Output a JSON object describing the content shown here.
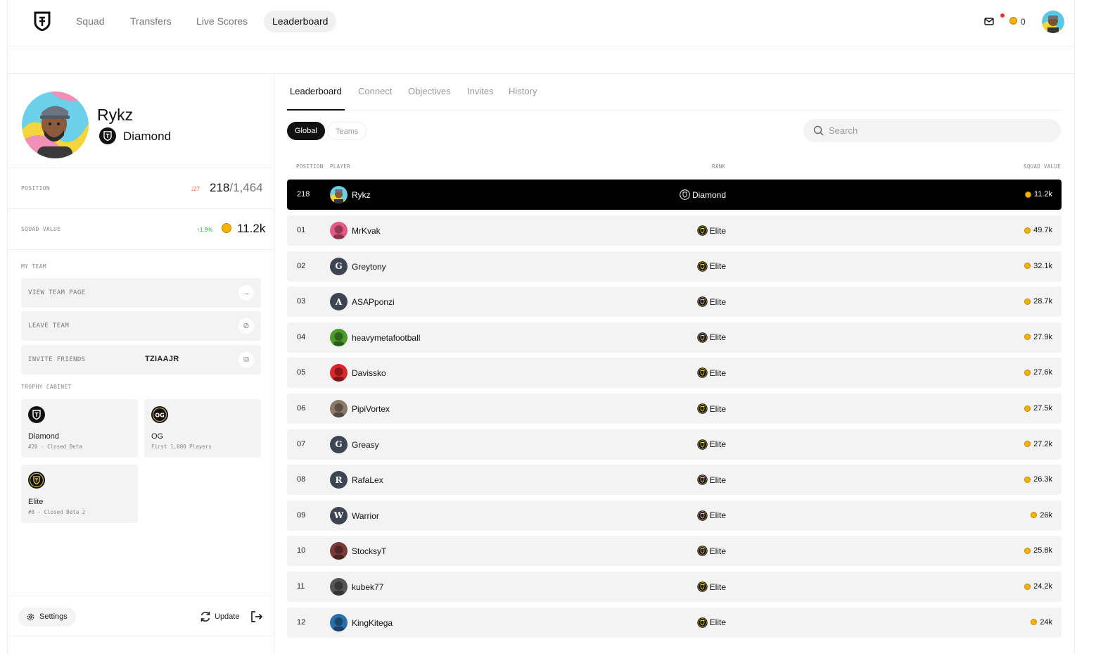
{
  "nav": {
    "items": [
      {
        "label": "Squad",
        "active": false
      },
      {
        "label": "Transfers",
        "active": false
      },
      {
        "label": "Live Scores",
        "active": false
      },
      {
        "label": "Leaderboard",
        "active": true
      }
    ],
    "coin_balance": "0",
    "icons": {
      "logo": "shield-logo-icon",
      "mail": "mail-icon",
      "coin": "coin-icon"
    }
  },
  "profile": {
    "name": "Rykz",
    "rank": "Diamond",
    "position": {
      "label": "POSITION",
      "delta": "↓27",
      "current": "218",
      "total": "/1,464"
    },
    "squad_value": {
      "label": "SQUAD VALUE",
      "delta": "↑1.9%",
      "value": "11.2k"
    },
    "my_team": {
      "label": "MY TEAM",
      "view_team": "VIEW TEAM PAGE",
      "leave_team": "LEAVE TEAM",
      "invite_friends": "INVITE FRIENDS",
      "invite_code": "TZIAAJR"
    },
    "trophy_cabinet": {
      "label": "TROPHY CABINET",
      "items": [
        {
          "name": "Diamond",
          "sub": "#20 - Closed Beta"
        },
        {
          "name": "OG",
          "sub": "First 1,000 Players"
        },
        {
          "name": "Elite",
          "sub": "#8 - Closed Beta 2"
        }
      ]
    },
    "footer": {
      "settings": "Settings",
      "update": "Update"
    }
  },
  "leaderboard": {
    "tabs": [
      "Leaderboard",
      "Connect",
      "Objectives",
      "Invites",
      "History"
    ],
    "filters": [
      "Global",
      "Teams"
    ],
    "search_placeholder": "Search",
    "columns": {
      "position": "POSITION",
      "player": "PLAYER",
      "rank": "RANK",
      "squad_value": "SQUAD VALUE"
    },
    "me": {
      "position": "218",
      "player": "Rykz",
      "rank": "Diamond",
      "value": "11.2k"
    },
    "rows": [
      {
        "position": "01",
        "player": "MrKvak",
        "rank": "Elite",
        "value": "49.7k",
        "avatar": {
          "type": "img",
          "color": "#e35a86"
        }
      },
      {
        "position": "02",
        "player": "Greytony",
        "rank": "Elite",
        "value": "32.1k",
        "avatar": {
          "type": "letter",
          "letter": "G",
          "color": "#3d4452"
        }
      },
      {
        "position": "03",
        "player": "ASAPponzi",
        "rank": "Elite",
        "value": "28.7k",
        "avatar": {
          "type": "letter",
          "letter": "A",
          "color": "#3d4452"
        }
      },
      {
        "position": "04",
        "player": "heavymetafootball",
        "rank": "Elite",
        "value": "27.9k",
        "avatar": {
          "type": "img",
          "color": "#4a9a2c"
        }
      },
      {
        "position": "05",
        "player": "Davissko",
        "rank": "Elite",
        "value": "27.6k",
        "avatar": {
          "type": "img",
          "color": "#d8262b"
        }
      },
      {
        "position": "06",
        "player": "PipiVortex",
        "rank": "Elite",
        "value": "27.5k",
        "avatar": {
          "type": "img",
          "color": "#8a7a6a"
        }
      },
      {
        "position": "07",
        "player": "Greasy",
        "rank": "Elite",
        "value": "27.2k",
        "avatar": {
          "type": "letter",
          "letter": "G",
          "color": "#3d4452"
        }
      },
      {
        "position": "08",
        "player": "RafaLex",
        "rank": "Elite",
        "value": "26.3k",
        "avatar": {
          "type": "letter",
          "letter": "R",
          "color": "#3d4452"
        }
      },
      {
        "position": "09",
        "player": "Warrior",
        "rank": "Elite",
        "value": "26k",
        "avatar": {
          "type": "letter",
          "letter": "W",
          "color": "#3d4452"
        }
      },
      {
        "position": "10",
        "player": "StocksyT",
        "rank": "Elite",
        "value": "25.8k",
        "avatar": {
          "type": "img",
          "color": "#7a3a3a"
        }
      },
      {
        "position": "11",
        "player": "kubek77",
        "rank": "Elite",
        "value": "24.2k",
        "avatar": {
          "type": "img",
          "color": "#555555"
        }
      },
      {
        "position": "12",
        "player": "KingKitega",
        "rank": "Elite",
        "value": "24k",
        "avatar": {
          "type": "img",
          "color": "#2b6fa8"
        }
      }
    ]
  }
}
